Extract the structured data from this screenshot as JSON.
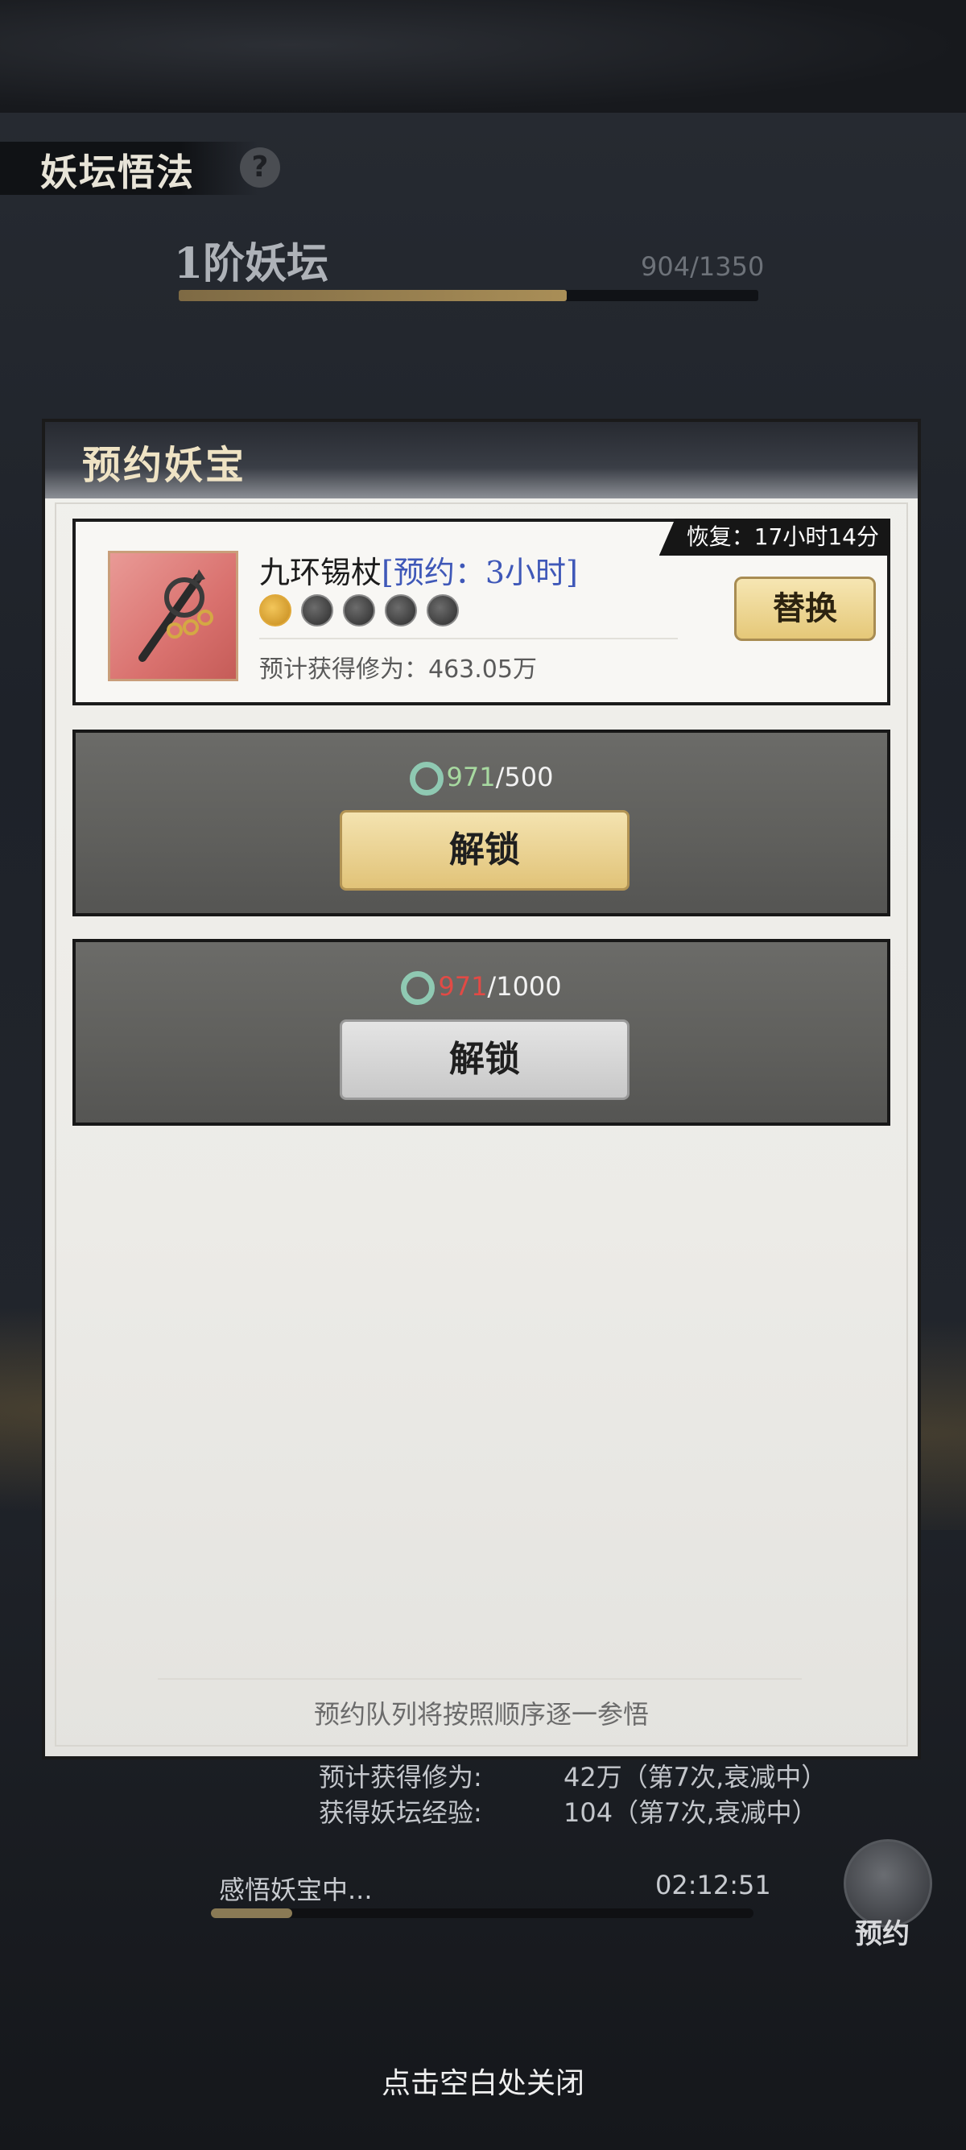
{
  "background": {
    "section_title": "妖坛悟法",
    "help_icon": "?",
    "level_label": "1阶妖坛",
    "level_progress_text": "904/1350",
    "level_progress_fraction": 0.67,
    "cultivation_label": "预计获得修为:",
    "cultivation_value": "42万（第7次,衰减中）",
    "exp_label": "获得妖坛经验:",
    "exp_value": "104（第7次,衰减中）",
    "progress_label": "感悟妖宝中...",
    "progress_time": "02:12:51",
    "progress_fraction": 0.15,
    "reserve_button": "预约"
  },
  "modal": {
    "title": "预约妖宝",
    "item": {
      "recover_label": "恢复：17小时14分",
      "name": "九环锡杖",
      "reserve_tag": "[预约：3小时]",
      "stars_total": 5,
      "stars_lit": 1,
      "gain_text": "预计获得修为：463.05万",
      "replace_button": "替换"
    },
    "slots": [
      {
        "have": "971",
        "need": "/500",
        "button": "解锁"
      },
      {
        "have": "971",
        "need": "/1000",
        "button": "解锁"
      }
    ],
    "queue_note": "预约队列将按照顺序逐一参悟"
  },
  "close_hint": "点击空白处关闭",
  "colors": {
    "reserve_tag": "#3f58b8",
    "cost_sufficient": "#a7d9a0",
    "cost_insufficient": "#e24a45",
    "gold_button": "#e1c378"
  }
}
